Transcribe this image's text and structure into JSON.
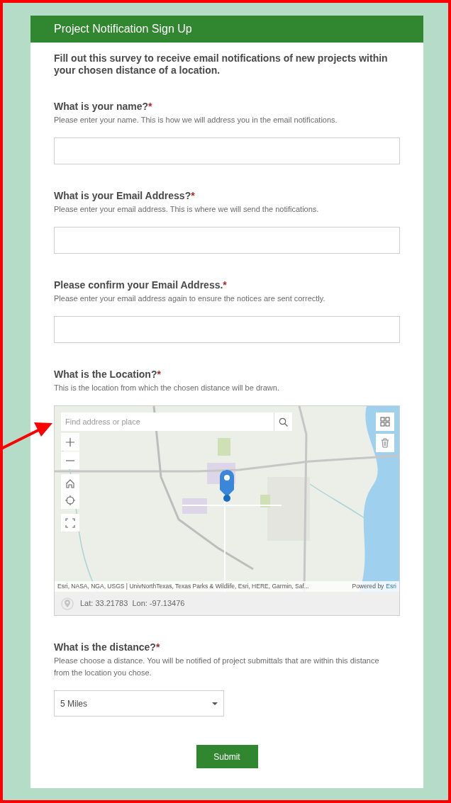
{
  "header": {
    "title": "Project Notification Sign Up"
  },
  "intro": "Fill out this survey to receive email notifications of new projects within your chosen distance of a location.",
  "questions": [
    {
      "kind": "text",
      "label": "What is your name?",
      "required_mark": "*",
      "hint": "Please enter your name. This is how we will address you in the email notifications."
    },
    {
      "kind": "text",
      "label": "What is your Email Address?",
      "required_mark": "*",
      "hint": "Please enter your email address. This is where we will send the notifications."
    },
    {
      "kind": "text",
      "label": "Please confirm your Email Address.",
      "required_mark": "*",
      "hint": "Please enter your email address again to ensure the notices are sent correctly."
    },
    {
      "kind": "map",
      "label": "What is the Location?",
      "required_mark": "*",
      "hint": "This is the location from which the chosen distance will be drawn.",
      "search_placeholder": "Find address or place",
      "attribution": "Esri, NASA, NGA, USGS | UnivNorthTexas, Texas Parks & Wildlife, Esri, HERE, Garmin, Saf...",
      "powered_by": "Powered by",
      "powered_link": "Esri",
      "coordinates": "Lat: 33.21783  Lon: -97.13476"
    },
    {
      "kind": "select",
      "label": "What is the distance?",
      "required_mark": "*",
      "hint": "Please choose a distance. You will be notified of project submittals that are within this distance from the location you chose.",
      "value": "5 Miles"
    }
  ],
  "submit": "Submit"
}
